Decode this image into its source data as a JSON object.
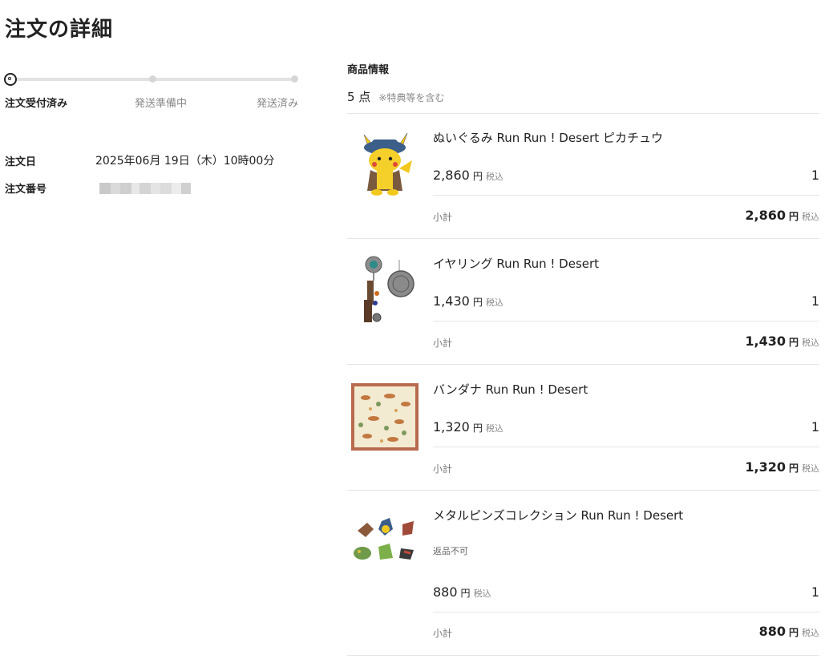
{
  "page": {
    "title": "注文の詳細"
  },
  "progress": {
    "steps": [
      "注文受付済み",
      "発送準備中",
      "発送済み"
    ],
    "current_step": 1
  },
  "order": {
    "date_label": "注文日",
    "date_value": "2025年06月 19日（木）10時00分",
    "number_label": "注文番号"
  },
  "products": {
    "section_title": "商品情報",
    "count": "5 点",
    "count_note": "※特典等を含む",
    "currency": "円",
    "tax_label": "税込",
    "subtotal_label": "小計",
    "items": [
      {
        "name": "ぬいぐるみ Run Run ! Desert ピカチュウ",
        "price": "2,860",
        "qty": "1",
        "subtotal": "2,860",
        "note": ""
      },
      {
        "name": "イヤリング Run Run ! Desert",
        "price": "1,430",
        "qty": "1",
        "subtotal": "1,430",
        "note": ""
      },
      {
        "name": "バンダナ Run Run ! Desert",
        "price": "1,320",
        "qty": "1",
        "subtotal": "1,320",
        "note": ""
      },
      {
        "name": "メタルピンズコレクション Run Run ! Desert",
        "price": "880",
        "qty": "1",
        "subtotal": "880",
        "note": "返品不可"
      }
    ]
  }
}
